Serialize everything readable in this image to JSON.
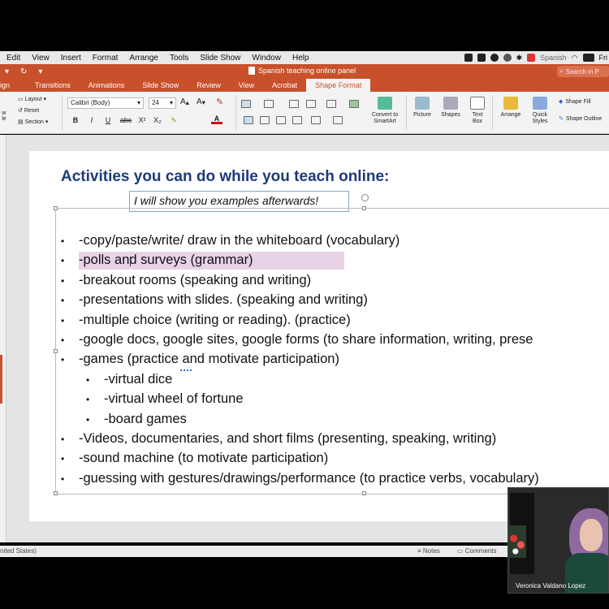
{
  "menubar": {
    "items": [
      "Edit",
      "View",
      "Insert",
      "Format",
      "Arrange",
      "Tools",
      "Slide Show",
      "Window",
      "Help"
    ],
    "input_language": "Spanish",
    "clock": "Fri"
  },
  "titlebar": {
    "document_title": "Spanish  teaching online panel",
    "search_placeholder": "Search in P"
  },
  "ribbon_tabs": {
    "items": [
      "ign",
      "Transitions",
      "Animations",
      "Slide Show",
      "Review",
      "View",
      "Acrobat",
      "Shape Format"
    ],
    "active": "Shape Format"
  },
  "ribbon": {
    "slide_group": {
      "layout": "Layout",
      "reset": "Reset",
      "section": "Section",
      "new_slide_partial": "w\nde"
    },
    "font_name": "Calibri (Body)",
    "font_size": "24",
    "bold": "B",
    "italic": "I",
    "underline": "U",
    "strike": "abc",
    "superscript": "X²",
    "subscript": "X₂",
    "convert_smartart": "Convert to SmartArt",
    "picture": "Picture",
    "shapes": "Shapes",
    "text_box": "Text Box",
    "arrange": "Arrange",
    "quick_styles": "Quick Styles",
    "shape_fill": "Shape Fill",
    "shape_outline": "Shape Outline"
  },
  "slide": {
    "title": "Activities you can do while you teach online:",
    "subtitle": "I will show you examples afterwards!",
    "bullets": [
      "-copy/paste/write/ draw in the whiteboard  (vocabulary)",
      "-polls  and surveys          (grammar)",
      "-breakout rooms      (speaking and writing)",
      "-presentations with slides.     (speaking and writing)",
      "-multiple choice (writing or reading).     (practice)",
      "-google docs, google sites, google forms      (to share information, writing, prese",
      " -games           (practice and motivate participation)",
      "-virtual dice",
      "-virtual wheel of fortune",
      "-board games",
      "-Videos, documentaries, and short films            (presenting, speaking, writing)",
      "-sound machine    (to motivate participation)",
      "-guessing with gestures/drawings/performance    (to practice verbs, vocabulary)"
    ]
  },
  "statusbar": {
    "language": "nited States)",
    "notes": "Notes",
    "comments": "Comments"
  },
  "video": {
    "participant_name": "Veronica Valdano Lopez"
  },
  "colors": {
    "ppt_accent": "#c8502b",
    "title_blue": "#1f3a7a",
    "highlight": "#e8d3e6"
  }
}
